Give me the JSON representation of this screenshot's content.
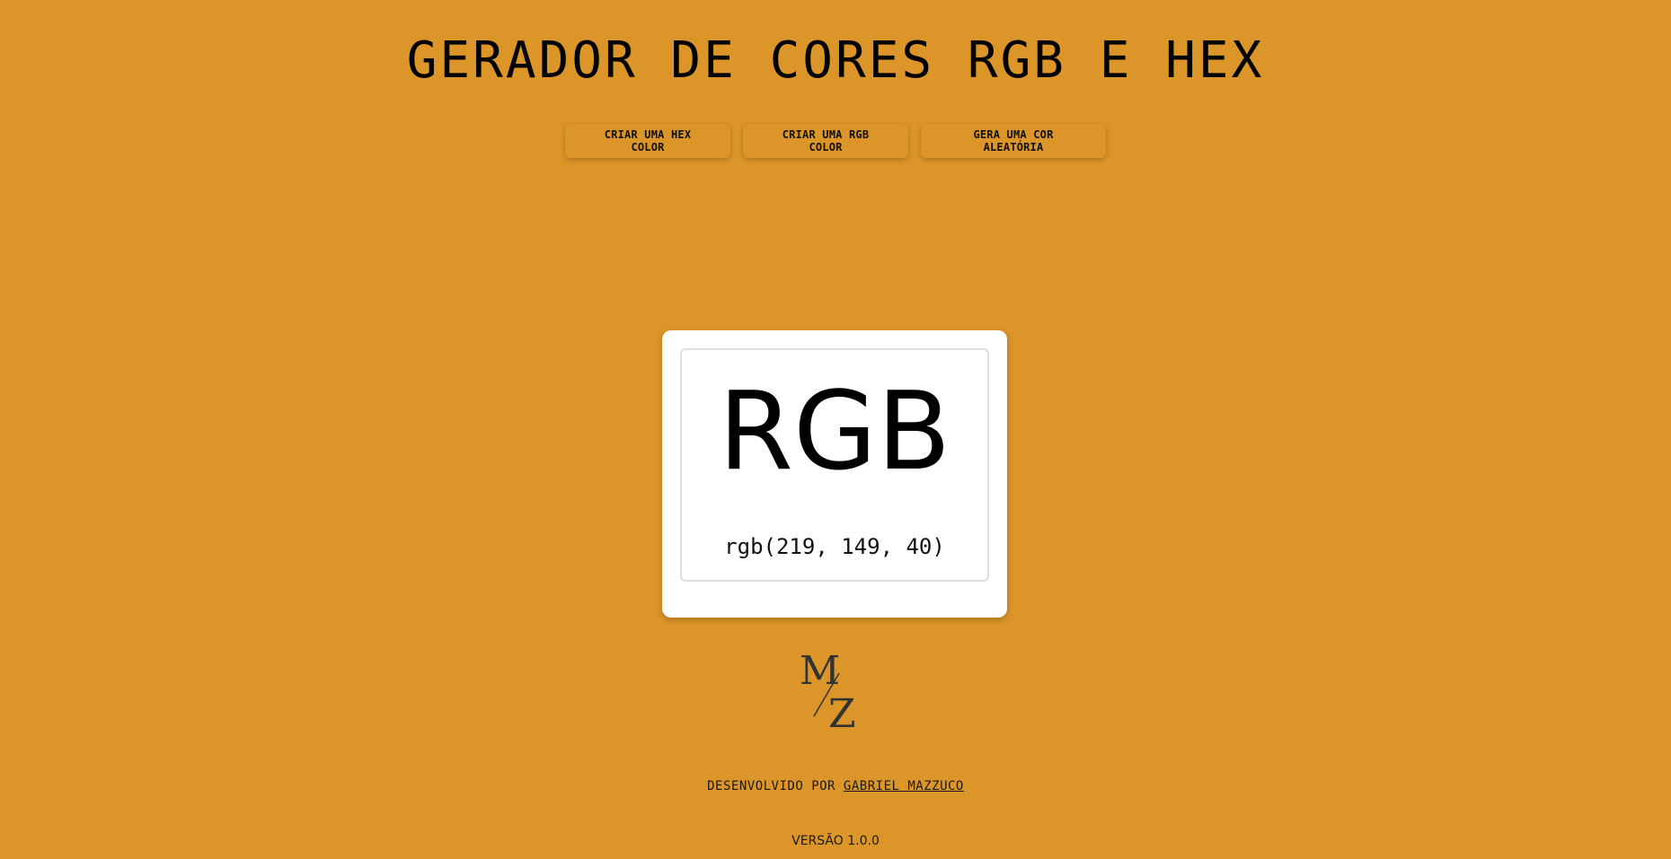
{
  "header": {
    "title": "GERADOR DE CORES RGB E HEX"
  },
  "actions": {
    "hex_label": "CRIAR UMA HEX COLOR",
    "rgb_label": "CRIAR UMA RGB COLOR",
    "random_label": "GERA UMA COR ALEATÓRIA"
  },
  "card": {
    "mode_label": "RGB",
    "color_value": "rgb(219, 149, 40)"
  },
  "logo": {
    "letters": "M/Z"
  },
  "footer": {
    "credit_prefix": "DESENVOLVIDO POR",
    "author_link": "GABRIEL MAZZUCO",
    "version": "VERSÃO 1.0.0"
  },
  "colors": {
    "background": "#db9528",
    "card": "#ffffff",
    "text": "#000000"
  }
}
